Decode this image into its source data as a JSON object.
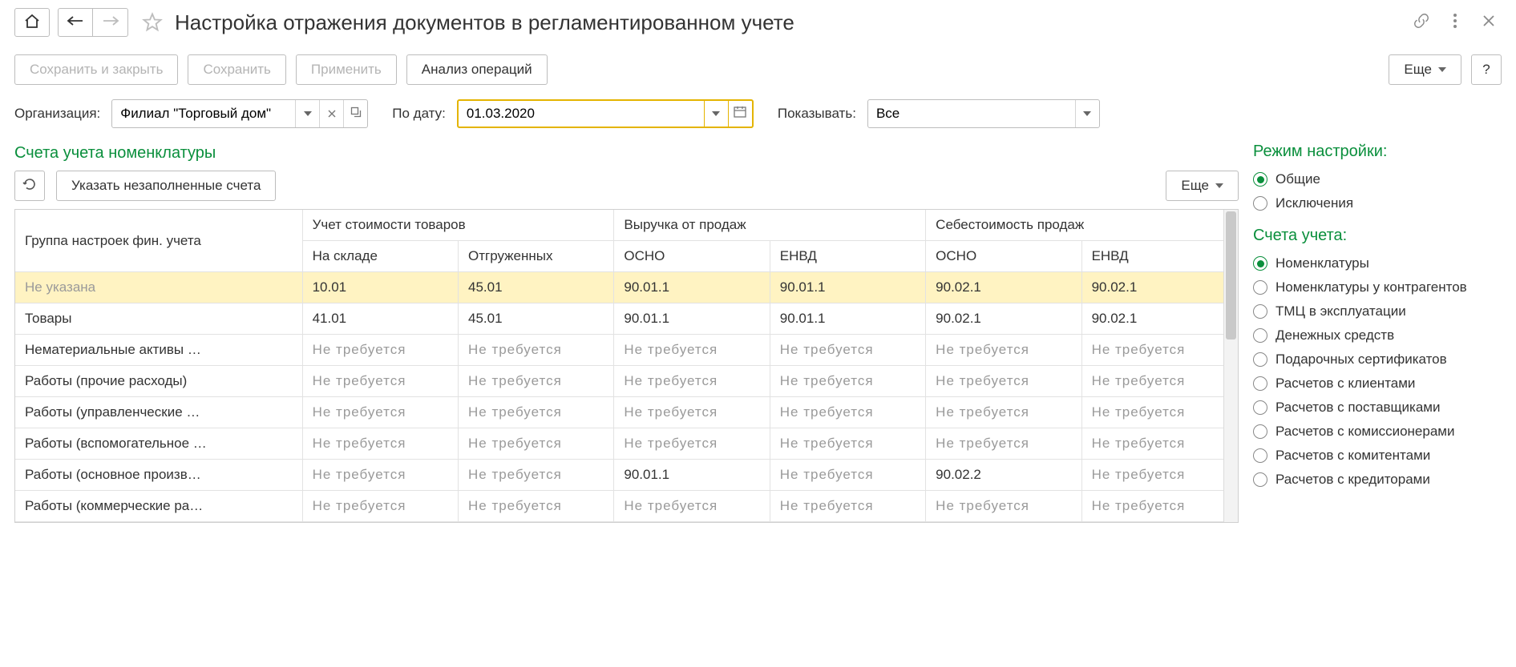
{
  "title": "Настройка отражения документов в регламентированном учете",
  "cmd": {
    "save_close": "Сохранить и закрыть",
    "save": "Сохранить",
    "apply": "Применить",
    "analyze": "Анализ операций",
    "more": "Еще",
    "help": "?"
  },
  "filters": {
    "org_label": "Организация:",
    "org_value": "Филиал \"Торговый дом\"",
    "date_label": "По дату:",
    "date_value": "01.03.2020",
    "show_label": "Показывать:",
    "show_value": "Все"
  },
  "section": {
    "title": "Счета учета номенклатуры",
    "fill_empty": "Указать незаполненные счета",
    "more": "Еще"
  },
  "table": {
    "head": {
      "group": "Группа настроек фин. учета",
      "stock": "Учет стоимости товаров",
      "stock_sub1": "На складе",
      "stock_sub2": "Отгруженных",
      "revenue": "Выручка от продаж",
      "cost": "Себестоимость продаж",
      "osno": "ОСНО",
      "envd": "ЕНВД"
    },
    "nr": "Не требуется",
    "rows": [
      {
        "name": "Не указана",
        "selected": true,
        "c": [
          "10.01",
          "45.01",
          "90.01.1",
          "90.01.1",
          "90.02.1",
          "90.02.1"
        ]
      },
      {
        "name": "Товары",
        "c": [
          "41.01",
          "45.01",
          "90.01.1",
          "90.01.1",
          "90.02.1",
          "90.02.1"
        ]
      },
      {
        "name": "Нематериальные активы …",
        "nr_all": true
      },
      {
        "name": "Работы (прочие расходы)",
        "nr_all": true
      },
      {
        "name": "Работы (управленческие …",
        "nr_all": true
      },
      {
        "name": "Работы (вспомогательное …",
        "nr_all": true
      },
      {
        "name": "Работы (основное произв…",
        "c": [
          "",
          "",
          "90.01.1",
          "",
          "90.02.2",
          ""
        ],
        "nr_blank": true
      },
      {
        "name": "Работы (коммерческие ра…",
        "nr_all": true
      }
    ]
  },
  "right": {
    "mode_title": "Режим настройки:",
    "mode_options": [
      {
        "label": "Общие",
        "checked": true
      },
      {
        "label": "Исключения",
        "checked": false
      }
    ],
    "accounts_title": "Счета учета:",
    "accounts_options": [
      {
        "label": "Номенклатуры",
        "checked": true
      },
      {
        "label": "Номенклатуры у контрагентов"
      },
      {
        "label": "ТМЦ в эксплуатации"
      },
      {
        "label": "Денежных средств"
      },
      {
        "label": "Подарочных сертификатов"
      },
      {
        "label": "Расчетов с клиентами"
      },
      {
        "label": "Расчетов с поставщиками"
      },
      {
        "label": "Расчетов с комиссионерами"
      },
      {
        "label": "Расчетов с комитентами"
      },
      {
        "label": "Расчетов с кредиторами"
      }
    ]
  }
}
